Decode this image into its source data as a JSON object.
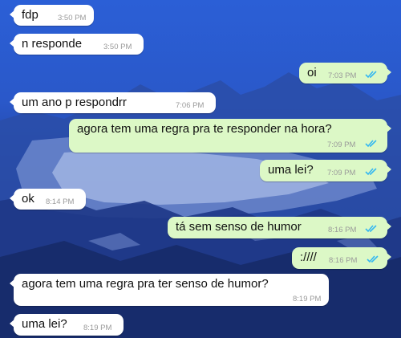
{
  "chat": {
    "messages": [
      {
        "direction": "in",
        "text": "fdp",
        "time": "3:50 PM"
      },
      {
        "direction": "in",
        "text": "n responde",
        "time": "3:50 PM"
      },
      {
        "direction": "out",
        "text": "oi",
        "time": "7:03 PM",
        "status_icon": "double-check-icon"
      },
      {
        "direction": "in",
        "text": "um ano p respondrr",
        "time": "7:06 PM"
      },
      {
        "direction": "out",
        "text": "agora tem uma regra pra te responder na hora?",
        "time": "7:09 PM",
        "status_icon": "double-check-icon"
      },
      {
        "direction": "out",
        "text": "uma lei?",
        "time": "7:09 PM",
        "status_icon": "double-check-icon"
      },
      {
        "direction": "in",
        "text": "ok",
        "time": "8:14 PM"
      },
      {
        "direction": "out",
        "text": "tá sem senso de humor",
        "time": "8:16 PM",
        "status_icon": "double-check-icon"
      },
      {
        "direction": "out",
        "text": ":////",
        "time": "8:16 PM",
        "status_icon": "double-check-icon"
      },
      {
        "direction": "in",
        "text": "agora tem uma regra pra ter senso de humor?",
        "time": "8:19 PM"
      },
      {
        "direction": "in",
        "text": "uma lei?",
        "time": "8:19 PM"
      }
    ]
  },
  "colors": {
    "incoming_bubble": "#ffffff",
    "outgoing_bubble": "#dcf8c6",
    "read_ticks": "#34b7f1",
    "timestamp": "#9a9a9a"
  }
}
